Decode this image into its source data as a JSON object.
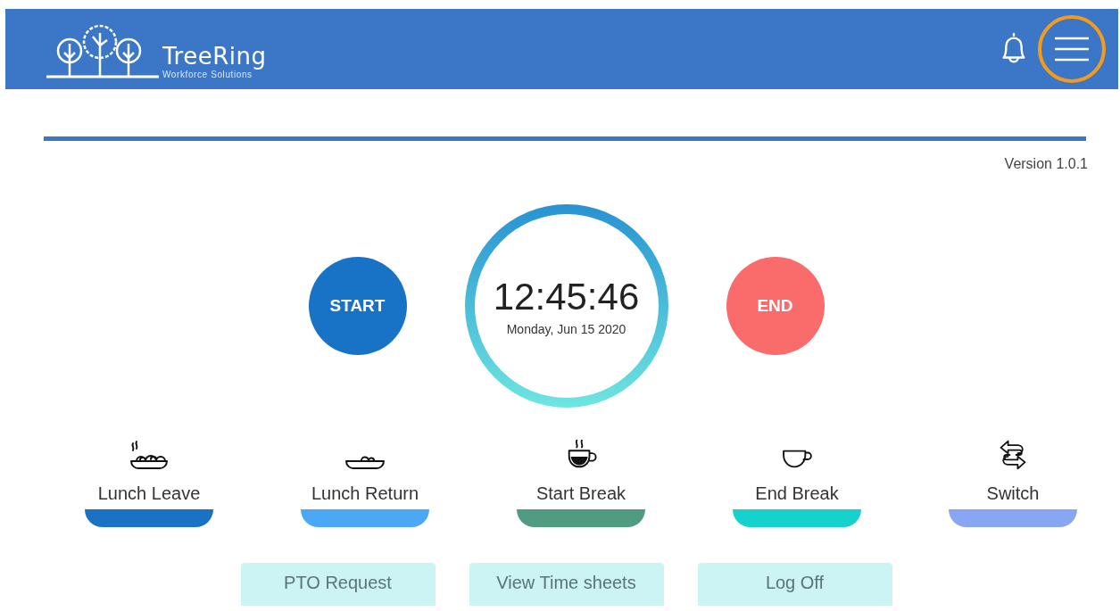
{
  "header": {
    "brand": "TreeRing",
    "tagline": "Workforce Solutions",
    "menu_highlighted": true
  },
  "version": "Version 1.0.1",
  "clock": {
    "start_label": "START",
    "time": "12:45:46",
    "date": "Monday, Jun 15 2020",
    "end_label": "END"
  },
  "actions": [
    {
      "label": "Lunch Leave",
      "color": "#1a72c4"
    },
    {
      "label": "Lunch Return",
      "color": "#4aa8f5"
    },
    {
      "label": "Start Break",
      "color": "#4f9c80"
    },
    {
      "label": "End Break",
      "color": "#15d2cc"
    },
    {
      "label": "Switch",
      "color": "#88a6f2"
    }
  ],
  "buttons": [
    "PTO Request",
    "View Time sheets",
    "Log Off"
  ]
}
